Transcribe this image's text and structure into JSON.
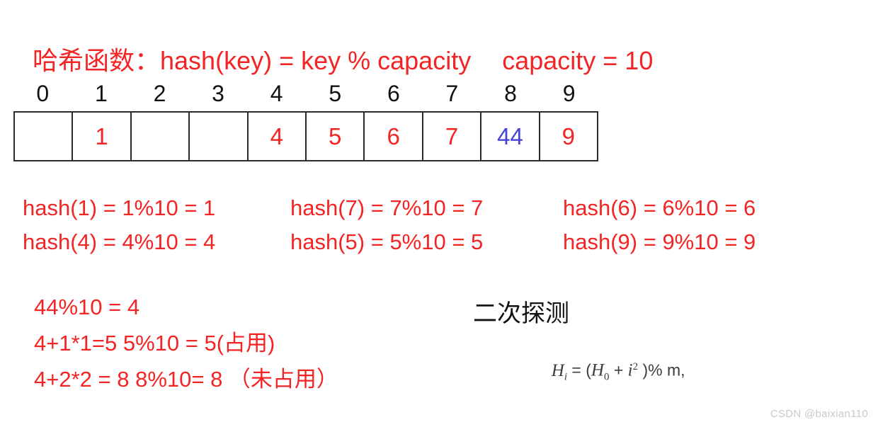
{
  "header": {
    "hash_function_label": "哈希函数：hash(key) = key % capacity",
    "capacity_label": "capacity = 10"
  },
  "table": {
    "indices": [
      "0",
      "1",
      "2",
      "3",
      "4",
      "5",
      "6",
      "7",
      "8",
      "9"
    ],
    "slots": [
      {
        "value": "",
        "color": "red",
        "empty": true
      },
      {
        "value": "1",
        "color": "red",
        "empty": false
      },
      {
        "value": "",
        "color": "red",
        "empty": true
      },
      {
        "value": "",
        "color": "red",
        "empty": true
      },
      {
        "value": "4",
        "color": "red",
        "empty": false
      },
      {
        "value": "5",
        "color": "red",
        "empty": false
      },
      {
        "value": "6",
        "color": "red",
        "empty": false
      },
      {
        "value": "7",
        "color": "red",
        "empty": false
      },
      {
        "value": "44",
        "color": "blue",
        "empty": false
      },
      {
        "value": "9",
        "color": "red",
        "empty": false
      }
    ]
  },
  "equations": {
    "row1": [
      "hash(1) = 1%10 = 1",
      "hash(7) = 7%10 = 7",
      "hash(6) = 6%10 = 6"
    ],
    "row2": [
      "hash(4) = 4%10 = 4",
      "hash(5) = 5%10 = 5",
      "hash(9) = 9%10 = 9"
    ]
  },
  "calculation": {
    "lines": [
      "44%10 = 4",
      "4+1*1=5 5%10 = 5(占用)",
      "4+2*2 = 8 8%10= 8 （未占用）"
    ]
  },
  "probing": {
    "title": "二次探测",
    "formula_parts": {
      "h": "H",
      "sub_i": "i",
      "equals": " = (",
      "h0": "H",
      "sub_0": "0",
      "plus": " + ",
      "i": "i",
      "sup_2": "2",
      "tail": " )% m,"
    }
  },
  "colors": {
    "red": "#f22424",
    "blue": "#4646d6",
    "ink": "#111111",
    "watermark": "#c9c9c9"
  },
  "watermark": {
    "text": "CSDN @baixian110"
  }
}
